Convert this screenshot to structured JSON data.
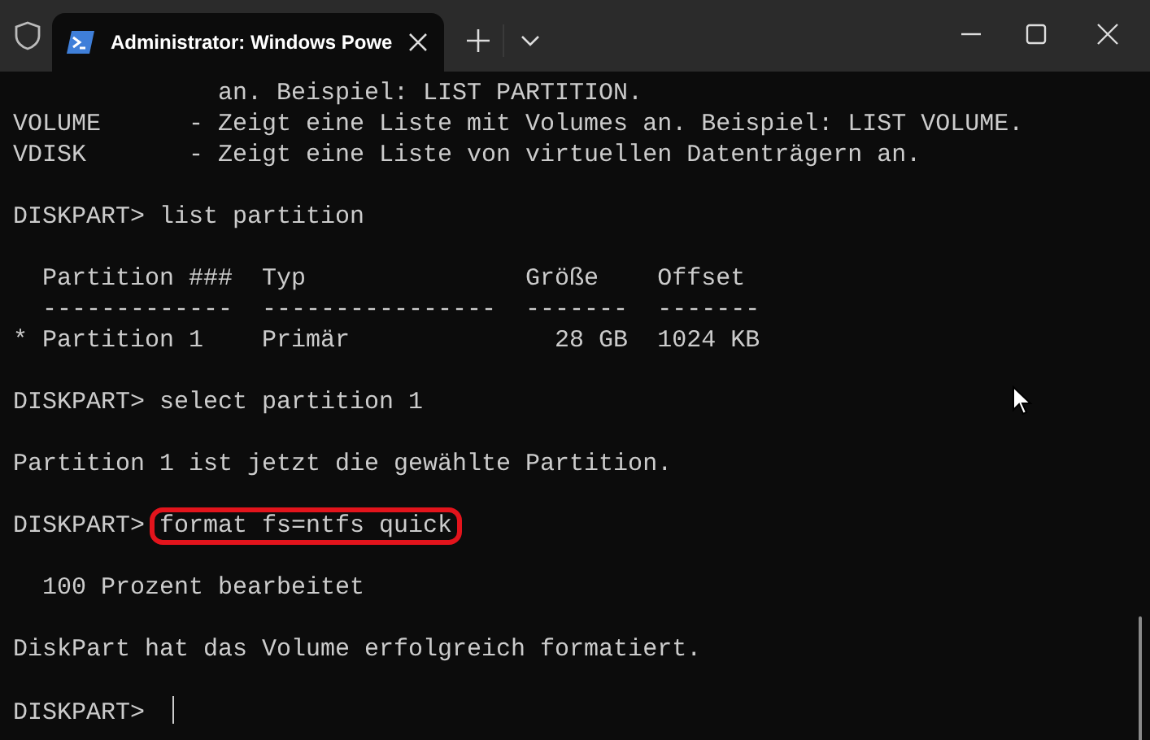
{
  "tab": {
    "title": "Administrator: Windows Powe",
    "selected": true
  },
  "terminal": {
    "lines": [
      {
        "kind": "text",
        "text": "              an. Beispiel: LIST PARTITION."
      },
      {
        "kind": "text",
        "text": "VOLUME      - Zeigt eine Liste mit Volumes an. Beispiel: LIST VOLUME."
      },
      {
        "kind": "text",
        "text": "VDISK       - Zeigt eine Liste von virtuellen Datenträgern an."
      },
      {
        "kind": "blank"
      },
      {
        "kind": "prompt",
        "prompt": "DISKPART>",
        "command": "list partition"
      },
      {
        "kind": "blank"
      },
      {
        "kind": "text",
        "text": "  Partition ###  Typ               Größe    Offset"
      },
      {
        "kind": "text",
        "text": "  -------------  ----------------  -------  -------"
      },
      {
        "kind": "text",
        "text": "* Partition 1    Primär              28 GB  1024 KB"
      },
      {
        "kind": "blank"
      },
      {
        "kind": "prompt",
        "prompt": "DISKPART>",
        "command": "select partition 1"
      },
      {
        "kind": "blank"
      },
      {
        "kind": "text",
        "text": "Partition 1 ist jetzt die gewählte Partition."
      },
      {
        "kind": "blank"
      },
      {
        "kind": "prompt",
        "prompt": "DISKPART>",
        "command": "format fs=ntfs quick",
        "highlighted": true
      },
      {
        "kind": "blank"
      },
      {
        "kind": "text",
        "text": "  100 Prozent bearbeitet"
      },
      {
        "kind": "blank"
      },
      {
        "kind": "text",
        "text": "DiskPart hat das Volume erfolgreich formatiert."
      },
      {
        "kind": "blank"
      },
      {
        "kind": "prompt",
        "prompt": "DISKPART>",
        "cursor": true
      }
    ]
  }
}
